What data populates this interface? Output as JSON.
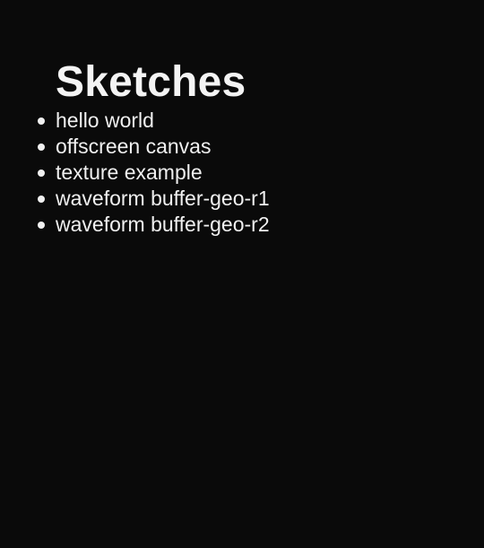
{
  "page": {
    "title": "Sketches"
  },
  "sketches": [
    {
      "label": "hello world"
    },
    {
      "label": "offscreen canvas"
    },
    {
      "label": "texture example"
    },
    {
      "label": "waveform buffer-geo-r1"
    },
    {
      "label": "waveform buffer-geo-r2"
    }
  ],
  "colors": {
    "background": "#0a0a0a",
    "text": "#f0f0f0"
  }
}
